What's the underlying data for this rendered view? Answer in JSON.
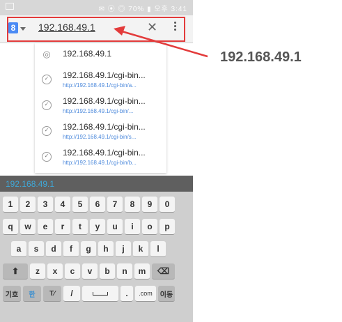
{
  "status_bar": {
    "right_text": "✉ ⦿ ◎ 70% ▮ 오후 3:41"
  },
  "address_bar": {
    "google_badge": "8",
    "url": "192.168.49.1"
  },
  "suggestions": [
    {
      "icon": "globe-icon",
      "title": "192.168.49.1",
      "sub": ""
    },
    {
      "icon": "history-icon",
      "title": "192.168.49.1/cgi-bin...",
      "sub": "http://192.168.49.1/cgi-bin/a..."
    },
    {
      "icon": "history-icon",
      "title": "192.168.49.1/cgi-bin...",
      "sub": "http://192.168.49.1/cgi-bin/..."
    },
    {
      "icon": "history-icon",
      "title": "192.168.49.1/cgi-bin...",
      "sub": "http://192.168.49.1/cgi-bin/s..."
    },
    {
      "icon": "history-icon",
      "title": "192.168.49.1/cgi-bin...",
      "sub": "http://192.168.49.1/cgi-bin/b..."
    }
  ],
  "keyboard": {
    "input_preview": "192.168.49.1",
    "row_numbers": [
      "1",
      "2",
      "3",
      "4",
      "5",
      "6",
      "7",
      "8",
      "9",
      "0"
    ],
    "row_q": [
      "q",
      "w",
      "e",
      "r",
      "t",
      "y",
      "u",
      "i",
      "o",
      "p"
    ],
    "row_a": [
      "a",
      "s",
      "d",
      "f",
      "g",
      "h",
      "j",
      "k",
      "l"
    ],
    "row_z": [
      "z",
      "x",
      "c",
      "v",
      "b",
      "n",
      "m"
    ],
    "bottom": {
      "symbols": "기호",
      "lang": "한",
      "handwriting": "T∕",
      "slash": "/",
      "dotcom": ".com",
      "move": "이동"
    }
  },
  "annotation": {
    "label": "192.168.49.1",
    "color": "#e33b3b"
  }
}
